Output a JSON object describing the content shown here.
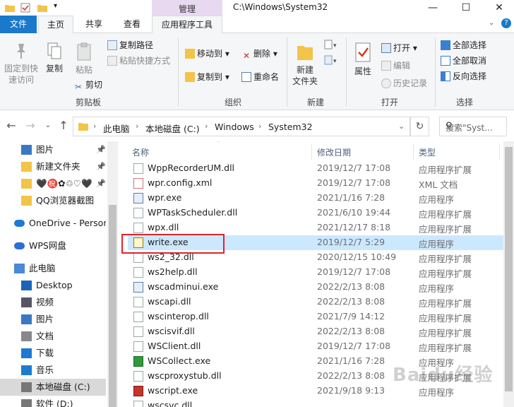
{
  "window": {
    "title": "C:\\Windows\\System32",
    "context_tab": "管理",
    "controls": [
      "—",
      "☐",
      "✕"
    ]
  },
  "ribbon_tabs": {
    "file": "文件",
    "home": "主页",
    "share": "共享",
    "view": "查看",
    "app_tools": "应用程序工具"
  },
  "ribbon": {
    "clipboard": {
      "pin_quick_access": [
        "固定到快",
        "速访问"
      ],
      "copy": "复制",
      "paste": "粘贴",
      "copy_path": "复制路径",
      "paste_shortcut": "粘贴快捷方式",
      "cut": "剪切",
      "group_label": "剪贴板"
    },
    "organize": {
      "move_to": "移动到",
      "delete": "删除",
      "copy_to": "复制到",
      "rename": "重命名",
      "group_label": "组织"
    },
    "new": {
      "new_folder": [
        "新建",
        "文件夹"
      ],
      "group_label": "新建"
    },
    "open": {
      "properties": "属性",
      "open": "打开",
      "edit": "编辑",
      "history": "历史记录",
      "group_label": "打开"
    },
    "select": {
      "select_all": "全部选择",
      "select_none": "全部取消",
      "invert": "反向选择",
      "group_label": "选择"
    }
  },
  "address": {
    "crumbs": [
      "此电脑",
      "本地磁盘 (C:)",
      "Windows",
      "System32"
    ],
    "search_placeholder": "搜索\"Syst..."
  },
  "nav_pane": [
    {
      "label": "图片",
      "icon": "pictures-icon",
      "pinned": true
    },
    {
      "label": "新建文件夹",
      "icon": "folder-icon",
      "pinned": true
    },
    {
      "label": "🖤㊗️✿♲♡🖤",
      "icon": "folder-icon",
      "pinned": true
    },
    {
      "label": "QQ浏览器截图",
      "icon": "folder-icon",
      "pinned": false
    },
    {
      "label": "OneDrive - Person",
      "icon": "onedrive-icon",
      "pinned": false
    },
    {
      "label": "WPS网盘",
      "icon": "wps-cloud-icon",
      "pinned": false
    },
    {
      "label": "此电脑",
      "icon": "this-pc-icon",
      "pinned": false
    },
    {
      "label": "Desktop",
      "icon": "desktop-icon",
      "pinned": false
    },
    {
      "label": "视频",
      "icon": "videos-icon",
      "pinned": false
    },
    {
      "label": "图片",
      "icon": "pictures-icon",
      "pinned": false
    },
    {
      "label": "文档",
      "icon": "documents-icon",
      "pinned": false
    },
    {
      "label": "下载",
      "icon": "downloads-icon",
      "pinned": false
    },
    {
      "label": "音乐",
      "icon": "music-icon",
      "pinned": false
    },
    {
      "label": "本地磁盘 (C:)",
      "icon": "drive-icon",
      "pinned": false
    },
    {
      "label": "软件 (D:)",
      "icon": "drive-icon",
      "pinned": false
    }
  ],
  "file_list": {
    "columns": [
      "名称",
      "修改日期",
      "类型"
    ],
    "rows": [
      {
        "name": "WppRecorderUM.dll",
        "date": "2019/12/7 17:08",
        "type": "应用程序扩展",
        "icon": "dll-icon"
      },
      {
        "name": "wpr.config.xml",
        "date": "2019/12/7 17:08",
        "type": "XML 文档",
        "icon": "xml-icon"
      },
      {
        "name": "wpr.exe",
        "date": "2021/1/16 7:28",
        "type": "应用程序",
        "icon": "exe-icon"
      },
      {
        "name": "WPTaskScheduler.dll",
        "date": "2021/6/10 19:44",
        "type": "应用程序扩展",
        "icon": "dll-icon"
      },
      {
        "name": "wpx.dll",
        "date": "2021/12/17 8:18",
        "type": "应用程序扩展",
        "icon": "dll-icon"
      },
      {
        "name": "write.exe",
        "date": "2019/12/7 5:29",
        "type": "应用程序",
        "icon": "write-exe-icon",
        "selected": true
      },
      {
        "name": "ws2_32.dll",
        "date": "2020/12/15 10:49",
        "type": "应用程序扩展",
        "icon": "dll-icon"
      },
      {
        "name": "ws2help.dll",
        "date": "2019/12/7 17:08",
        "type": "应用程序扩展",
        "icon": "dll-icon"
      },
      {
        "name": "wscadminui.exe",
        "date": "2022/2/13 8:08",
        "type": "应用程序",
        "icon": "exe-icon"
      },
      {
        "name": "wscapi.dll",
        "date": "2022/2/13 8:08",
        "type": "应用程序扩展",
        "icon": "dll-icon"
      },
      {
        "name": "wscinterop.dll",
        "date": "2021/7/9 14:12",
        "type": "应用程序扩展",
        "icon": "dll-icon"
      },
      {
        "name": "wscisvif.dll",
        "date": "2022/2/13 8:08",
        "type": "应用程序扩展",
        "icon": "dll-icon"
      },
      {
        "name": "WSClient.dll",
        "date": "2019/12/7 17:08",
        "type": "应用程序扩展",
        "icon": "dll-icon"
      },
      {
        "name": "WSCollect.exe",
        "date": "2021/1/16 7:28",
        "type": "应用程序",
        "icon": "wscollect-exe-icon"
      },
      {
        "name": "wscproxystub.dll",
        "date": "2022/2/13 8:08",
        "type": "应用程序扩展",
        "icon": "dll-icon"
      },
      {
        "name": "wscript.exe",
        "date": "2021/9/18 9:13",
        "type": "应用程序",
        "icon": "wscript-exe-icon"
      },
      {
        "name": "wscsvc.dll",
        "date": "",
        "type": "",
        "icon": "dll-icon"
      }
    ]
  },
  "watermark": "Baidu经验"
}
